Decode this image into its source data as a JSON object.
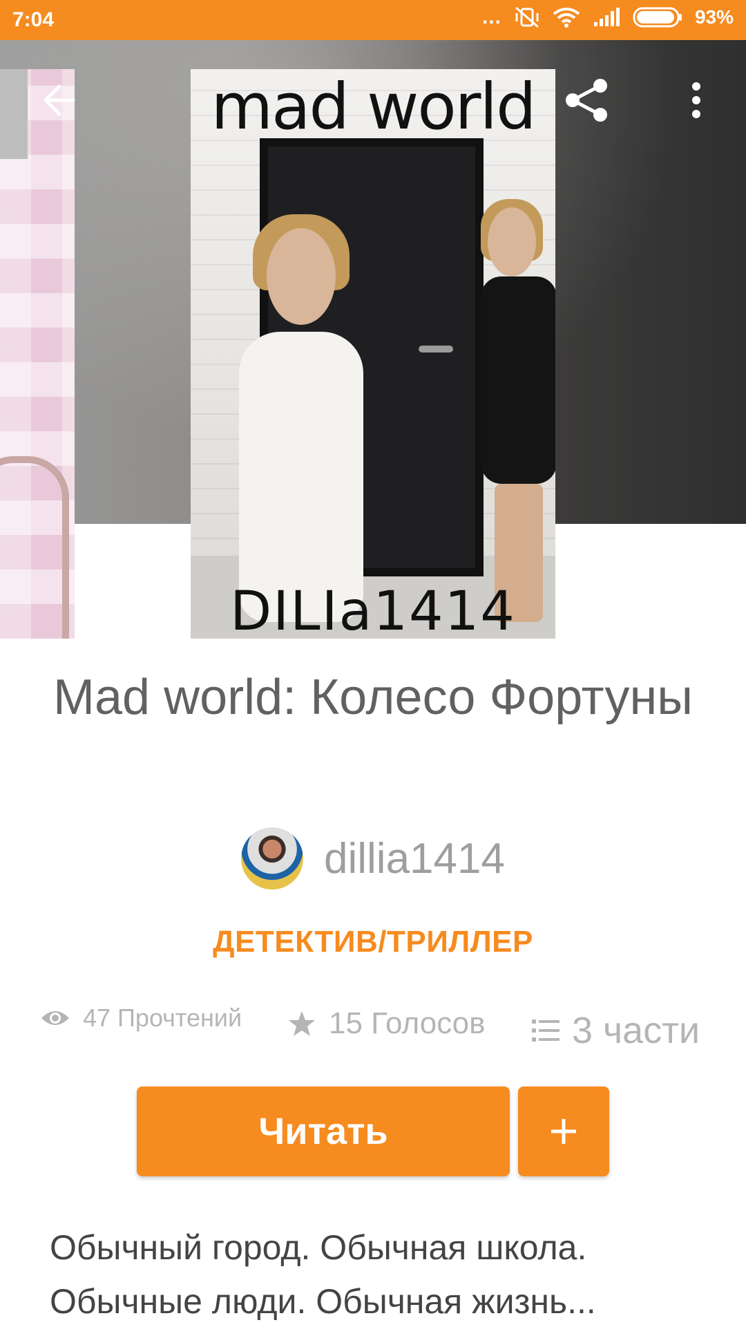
{
  "status_bar": {
    "time": "7:04",
    "dots": "...",
    "battery": "93%"
  },
  "colors": {
    "accent": "#f68b1f",
    "title_text": "#616161",
    "muted_text": "#b5b5b5"
  },
  "header": {
    "back_icon": "back-arrow-icon",
    "share_icon": "share-icon",
    "more_icon": "more-vert-icon"
  },
  "cover": {
    "title_text": "mad world",
    "author_text": "DILIa1414"
  },
  "story": {
    "title": "Mad world: Колесо Фортуны",
    "author": "dillia1414",
    "genre": "ДЕТЕКТИВ/ТРИЛЛЕР",
    "reads": "47 Прочтений",
    "votes": "15 Голосов",
    "parts": "3 части",
    "description": "Обычный город. Обычная школа. Обычные люди. Обычная жизнь..."
  },
  "actions": {
    "read_label": "Читать",
    "add_label": "+"
  }
}
